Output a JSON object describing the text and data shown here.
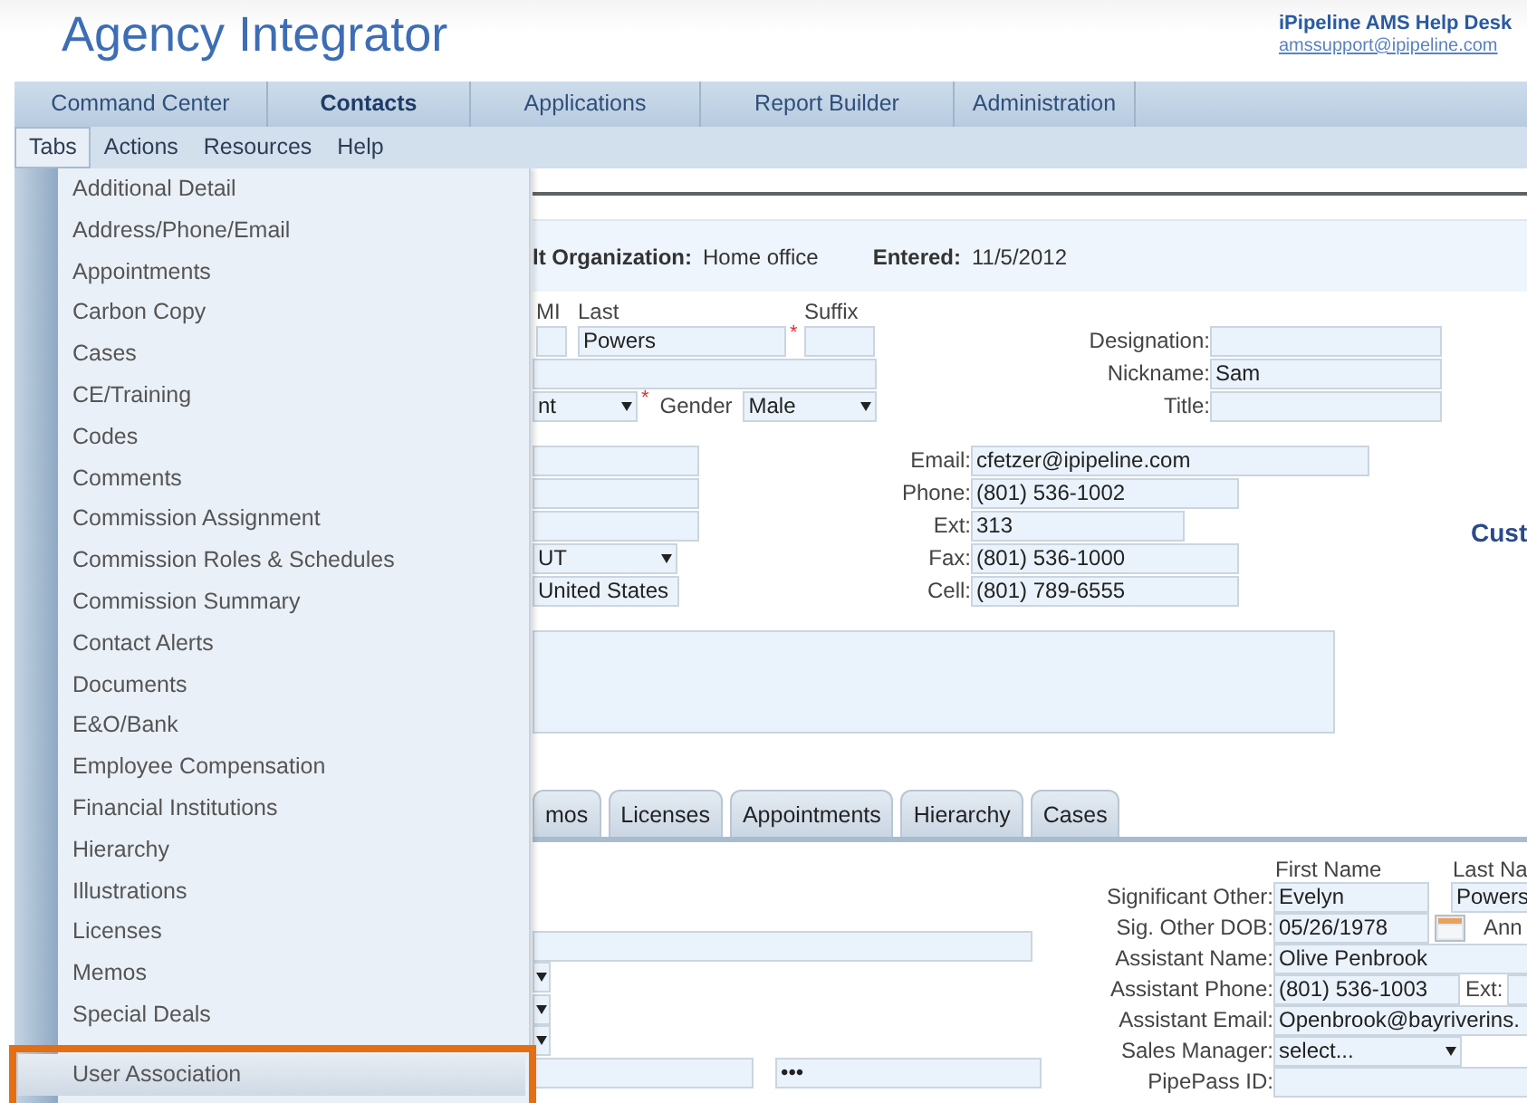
{
  "header": {
    "title": "Agency Integrator",
    "help_desk": "iPipeline AMS Help Desk",
    "help_email": "amssupport@ipipeline.com"
  },
  "main_nav": [
    {
      "label": "Command Center",
      "selected": false
    },
    {
      "label": "Contacts",
      "selected": true
    },
    {
      "label": "Applications",
      "selected": false
    },
    {
      "label": "Report Builder",
      "selected": false
    },
    {
      "label": "Administration",
      "selected": false
    }
  ],
  "sub_nav": [
    {
      "label": "Tabs",
      "selected": true
    },
    {
      "label": "Actions",
      "selected": false
    },
    {
      "label": "Resources",
      "selected": false
    },
    {
      "label": "Help",
      "selected": false
    }
  ],
  "tabs_menu": [
    {
      "label": "Additional Detail",
      "selected": false
    },
    {
      "label": "Address/Phone/Email",
      "selected": false
    },
    {
      "label": "Appointments",
      "selected": false
    },
    {
      "label": "Carbon Copy",
      "selected": false
    },
    {
      "label": "Cases",
      "selected": false
    },
    {
      "label": "CE/Training",
      "selected": false
    },
    {
      "label": "Codes",
      "selected": false
    },
    {
      "label": "Comments",
      "selected": false
    },
    {
      "label": "Commission Assignment",
      "selected": false
    },
    {
      "label": "Commission Roles & Schedules",
      "selected": false
    },
    {
      "label": "Commission Summary",
      "selected": false
    },
    {
      "label": "Contact Alerts",
      "selected": false
    },
    {
      "label": "Documents",
      "selected": false
    },
    {
      "label": "E&O/Bank",
      "selected": false
    },
    {
      "label": "Employee Compensation",
      "selected": false
    },
    {
      "label": "Financial Institutions",
      "selected": false
    },
    {
      "label": "Hierarchy",
      "selected": false
    },
    {
      "label": "Illustrations",
      "selected": false
    },
    {
      "label": "Licenses",
      "selected": false
    },
    {
      "label": "Memos",
      "selected": false
    },
    {
      "label": "Special Deals",
      "selected": false
    },
    {
      "label": "User Association",
      "selected": true
    }
  ],
  "summary": [
    {
      "label": "lt Organization:",
      "value": "Home office"
    },
    {
      "label": "Entered:",
      "value": "11/5/2012"
    }
  ],
  "name_labels": [
    "MI",
    "Last",
    "Suffix"
  ],
  "last_name": {
    "value": "Powers",
    "required_mark": "*"
  },
  "prefix_select": {
    "value": "nt",
    "required_mark": "*"
  },
  "gender": {
    "label": "Gender",
    "value": "Male"
  },
  "profile_fields": [
    {
      "label": "Designation:"
    },
    {
      "label": "Nickname:",
      "value": "Sam"
    },
    {
      "label": "Title:"
    }
  ],
  "address": {
    "state": "UT",
    "country": "United States"
  },
  "contact_fields": [
    {
      "label": "Email:",
      "value": "cfetzer@ipipeline.com"
    },
    {
      "label": "Phone:",
      "value": "(801) 536-1002"
    },
    {
      "label": "Ext:",
      "value": "313"
    },
    {
      "label": "Fax:",
      "value": "(801) 536-1000"
    },
    {
      "label": "Cell:",
      "value": "(801) 789-6555"
    }
  ],
  "section_heading": "Cust",
  "detail_tabs": [
    "mos",
    "Licenses",
    "Appointments",
    "Hierarchy",
    "Cases"
  ],
  "password_mask": "•••",
  "related_columns": [
    "First Name",
    "Last Na"
  ],
  "related_fields": [
    {
      "kind": "pair",
      "label": "Significant Other:",
      "value": "Evelyn",
      "value_2": "Powers"
    },
    {
      "kind": "date",
      "label": "Sig. Other DOB:",
      "value": "05/26/1978",
      "extra": "Ann"
    },
    {
      "kind": "text",
      "label": "Assistant Name:",
      "value": "Olive Penbrook"
    },
    {
      "kind": "phone",
      "label": "Assistant Phone:",
      "value": "(801) 536-1003",
      "extra": "Ext:"
    },
    {
      "kind": "text",
      "label": "Assistant Email:",
      "value": "Openbrook@bayriverins."
    },
    {
      "kind": "select",
      "label": "Sales Manager:",
      "value": "select..."
    },
    {
      "kind": "text",
      "label": "PipePass ID:"
    }
  ]
}
